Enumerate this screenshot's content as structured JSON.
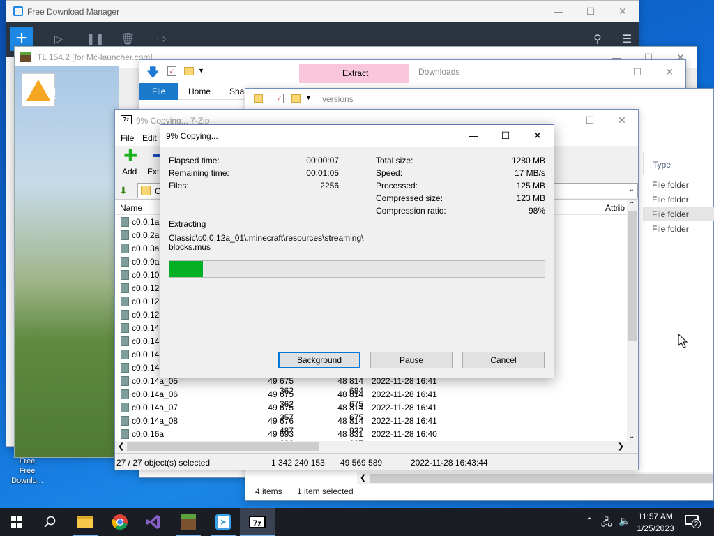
{
  "desktop": {
    "icon_fdm_label": "Free Downlo..."
  },
  "fdm": {
    "title": "Free Download Manager",
    "add_label": "+"
  },
  "tl": {
    "title": "TL 154.2 [for Mc-launcher.com]"
  },
  "explorer1": {
    "context_tab": "Extract",
    "title": "Downloads",
    "tabs": [
      "File",
      "Home",
      "Shar"
    ]
  },
  "explorer2": {
    "title": "versions",
    "type_header": "Type",
    "type_rows": [
      "File folder",
      "File folder",
      "File folder",
      "File folder"
    ],
    "status_items": "4 items",
    "status_selected": "1 item selected"
  },
  "zip": {
    "title": "9% Copying... 7-Zip",
    "menu": [
      "File",
      "Edit"
    ],
    "tool_add": "Add",
    "tool_extract": "Extr",
    "addr_text": "C",
    "col_name": "Name",
    "col_attrib": "Attrib",
    "rows": [
      {
        "name": "c0.0.1a",
        "size": "",
        "packed": "",
        "modified": ""
      },
      {
        "name": "c0.0.2a",
        "size": "",
        "packed": "",
        "modified": ""
      },
      {
        "name": "c0.0.3a",
        "size": "",
        "packed": "",
        "modified": ""
      },
      {
        "name": "c0.0.9a",
        "size": "",
        "packed": "",
        "modified": ""
      },
      {
        "name": "c0.0.10a",
        "size": "",
        "packed": "",
        "modified": ""
      },
      {
        "name": "c0.0.12a",
        "size": "",
        "packed": "",
        "modified": ""
      },
      {
        "name": "c0.0.12a",
        "size": "",
        "packed": "",
        "modified": ""
      },
      {
        "name": "c0.0.12a",
        "size": "",
        "packed": "",
        "modified": ""
      },
      {
        "name": "c0.0.14a",
        "size": "",
        "packed": "",
        "modified": ""
      },
      {
        "name": "c0.0.14a",
        "size": "",
        "packed": "",
        "modified": ""
      },
      {
        "name": "c0.0.14a",
        "size": "",
        "packed": "",
        "modified": ""
      },
      {
        "name": "c0.0.14a",
        "size": "",
        "packed": "",
        "modified": ""
      },
      {
        "name": "c0.0.14a_05",
        "size": "49 675 362",
        "packed": "48 814 684",
        "modified": "2022-11-28 16:41"
      },
      {
        "name": "c0.0.14a_06",
        "size": "49 675 362",
        "packed": "48 814 675",
        "modified": "2022-11-28 16:41"
      },
      {
        "name": "c0.0.14a_07",
        "size": "49 675 357",
        "packed": "48 814 675",
        "modified": "2022-11-28 16:41"
      },
      {
        "name": "c0.0.14a_08",
        "size": "49 676 487",
        "packed": "48 814 932",
        "modified": "2022-11-28 16:41"
      },
      {
        "name": "c0.0.16a",
        "size": "49 693 606",
        "packed": "48 831 907",
        "modified": "2022-11-28 16:40"
      }
    ],
    "status": {
      "selected": "27 / 27 object(s) selected",
      "size": "1 342 240 153",
      "packed": "49 569 589",
      "modified": "2022-11-28 16:43:44"
    }
  },
  "dialog": {
    "title": "9% Copying...",
    "elapsed_label": "Elapsed time:",
    "elapsed_value": "00:00:07",
    "remaining_label": "Remaining time:",
    "remaining_value": "00:01:05",
    "files_label": "Files:",
    "files_value": "2256",
    "total_label": "Total size:",
    "total_value": "1280 MB",
    "speed_label": "Speed:",
    "speed_value": "17 MB/s",
    "processed_label": "Processed:",
    "processed_value": "125 MB",
    "compressed_label": "Compressed size:",
    "compressed_value": "123 MB",
    "ratio_label": "Compression ratio:",
    "ratio_value": "98%",
    "action_label": "Extracting",
    "path_line1": "Classic\\c0.0.12a_01\\.minecraft\\resources\\streaming\\",
    "path_line2": "blocks.mus",
    "progress_fraction": 0.09,
    "btn_background": "Background",
    "btn_pause": "Pause",
    "btn_cancel": "Cancel",
    "progress_color": "#06b025"
  },
  "taskbar": {
    "time": "11:57 AM",
    "date": "1/25/2023",
    "notification_count": "2",
    "apps": [
      "start-icon",
      "search-icon",
      "file-explorer-icon",
      "chrome-icon",
      "visual-studio-icon",
      "minecraft-icon",
      "fdm-icon",
      "7zip-icon"
    ]
  }
}
